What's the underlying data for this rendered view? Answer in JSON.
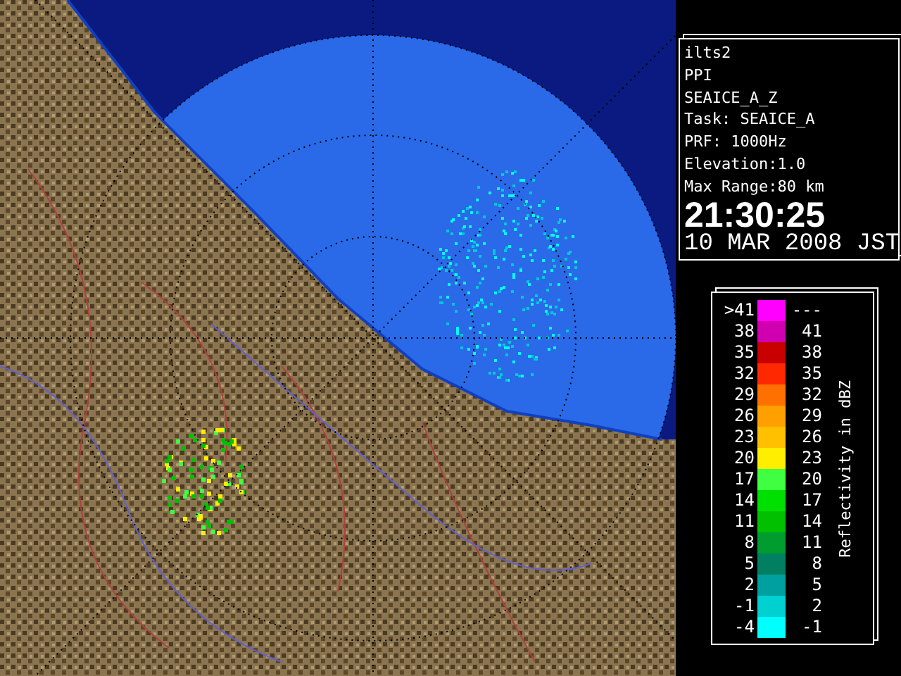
{
  "info": {
    "lines": [
      "ilts2",
      "PPI",
      "SEAICE_A_Z",
      "Task: SEAICE_A",
      "PRF: 1000Hz",
      "Elevation:1.0",
      "Max Range:80 km"
    ],
    "time": "21:30:25",
    "date": "10 MAR 2008 JST"
  },
  "legend": {
    "title": "Reflectivity in dBZ",
    "rows": [
      {
        "low": ">41",
        "high": "---",
        "color": "#ff00ff"
      },
      {
        "low": "38",
        "high": "41",
        "color": "#d000b0"
      },
      {
        "low": "35",
        "high": "38",
        "color": "#c80000"
      },
      {
        "low": "32",
        "high": "35",
        "color": "#ff2800"
      },
      {
        "low": "29",
        "high": "32",
        "color": "#ff7000"
      },
      {
        "low": "26",
        "high": "29",
        "color": "#ffa000"
      },
      {
        "low": "23",
        "high": "26",
        "color": "#ffc000"
      },
      {
        "low": "20",
        "high": "23",
        "color": "#ffee00"
      },
      {
        "low": "17",
        "high": "20",
        "color": "#40ff40"
      },
      {
        "low": "14",
        "high": "17",
        "color": "#00e000"
      },
      {
        "low": "11",
        "high": "14",
        "color": "#00c000"
      },
      {
        "low": "8",
        "high": "11",
        "color": "#009c30"
      },
      {
        "low": "5",
        "high": "8",
        "color": "#008060"
      },
      {
        "low": "2",
        "high": "5",
        "color": "#00a0a0"
      },
      {
        "low": "-1",
        "high": "2",
        "color": "#00d0d0"
      },
      {
        "low": "-4",
        "high": "-1",
        "color": "#00ffff"
      }
    ]
  }
}
